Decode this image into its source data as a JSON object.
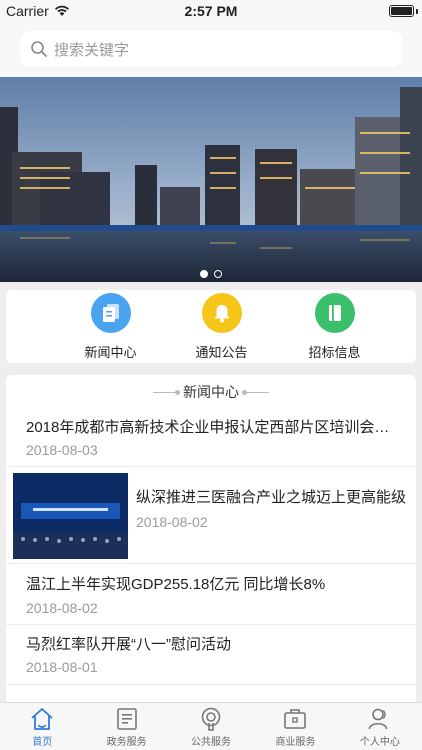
{
  "status": {
    "carrier": "Carrier",
    "time": "2:57 PM",
    "battery_level": 1.0
  },
  "search": {
    "placeholder": "搜索关键字",
    "icon": "search-icon"
  },
  "banner": {
    "slides": 2,
    "active_slide": 0
  },
  "quick_links": [
    {
      "label": "新闻中心",
      "icon": "documents-icon",
      "color": "#4aa3ee"
    },
    {
      "label": "通知公告",
      "icon": "bell-icon",
      "color": "#f5c518"
    },
    {
      "label": "招标信息",
      "icon": "book-icon",
      "color": "#3bbf6b"
    }
  ],
  "news": {
    "section_title": "新闻中心",
    "items": [
      {
        "title": "2018年成都市高新技术企业申报认定西部片区培训会…",
        "date": "2018-08-03"
      },
      {
        "title": "纵深推进三医融合产业之城迈上更高能级",
        "date": "2018-08-02",
        "has_thumb": true
      },
      {
        "title": "温江上半年实现GDP255.18亿元 同比增长8%",
        "date": "2018-08-02"
      },
      {
        "title": "马烈红率队开展“八一”慰问活动",
        "date": "2018-08-01"
      }
    ]
  },
  "tabs": [
    {
      "label": "首页",
      "icon": "home-icon",
      "active": true
    },
    {
      "label": "政务服务",
      "icon": "government-icon"
    },
    {
      "label": "公共服务",
      "icon": "public-service-icon"
    },
    {
      "label": "商业服务",
      "icon": "briefcase-icon"
    },
    {
      "label": "个人中心",
      "icon": "user-icon"
    }
  ],
  "colors": {
    "accent": "#2f7bd9",
    "muted": "#9a9a9a"
  }
}
